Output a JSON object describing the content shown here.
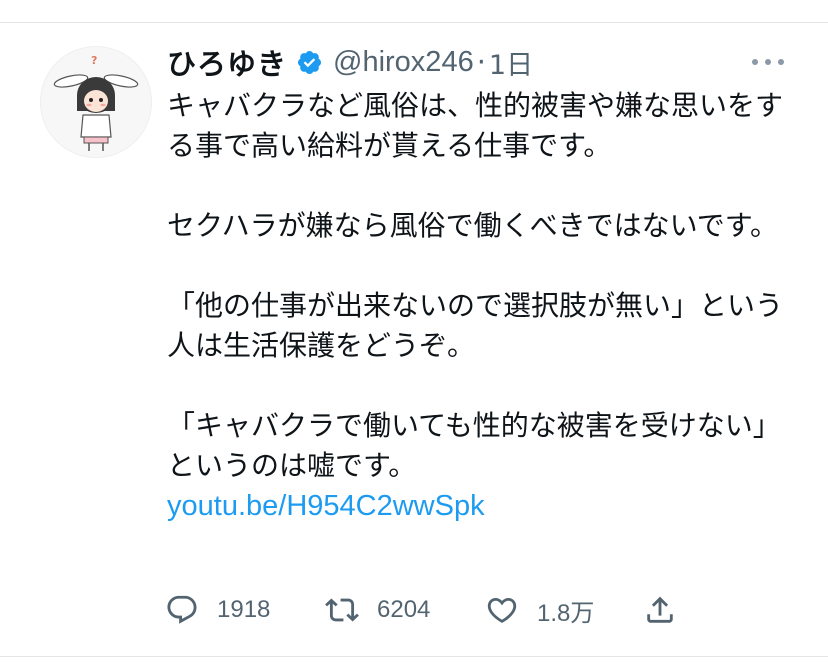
{
  "tweet": {
    "display_name": "ひろゆき",
    "handle": "@hirox246",
    "separator": "·",
    "time": "1日",
    "paragraphs": [
      "キャバクラなど風俗は、性的被害や嫌な思いをする事で高い給料が貰える仕事です。",
      "セクハラが嫌なら風俗で働くべきではないです。",
      "「他の仕事が出来ないので選択肢が無い」という人は生活保護をどうぞ。",
      "「キャバクラで働いても性的な被害を受けない」というのは嘘です。"
    ],
    "link": "youtu.be/H954C2wwSpk"
  },
  "actions": {
    "reply_count": "1918",
    "retweet_count": "6204",
    "like_count": "1.8万"
  },
  "icons": {
    "verified": "verified-badge-icon",
    "more": "more-options-icon",
    "reply": "reply-icon",
    "retweet": "retweet-icon",
    "like": "heart-icon",
    "share": "share-icon"
  },
  "colors": {
    "link": "#1d9bf0",
    "verified": "#1d9bf0",
    "secondary_text": "#536471",
    "primary_text": "#0f1419"
  }
}
